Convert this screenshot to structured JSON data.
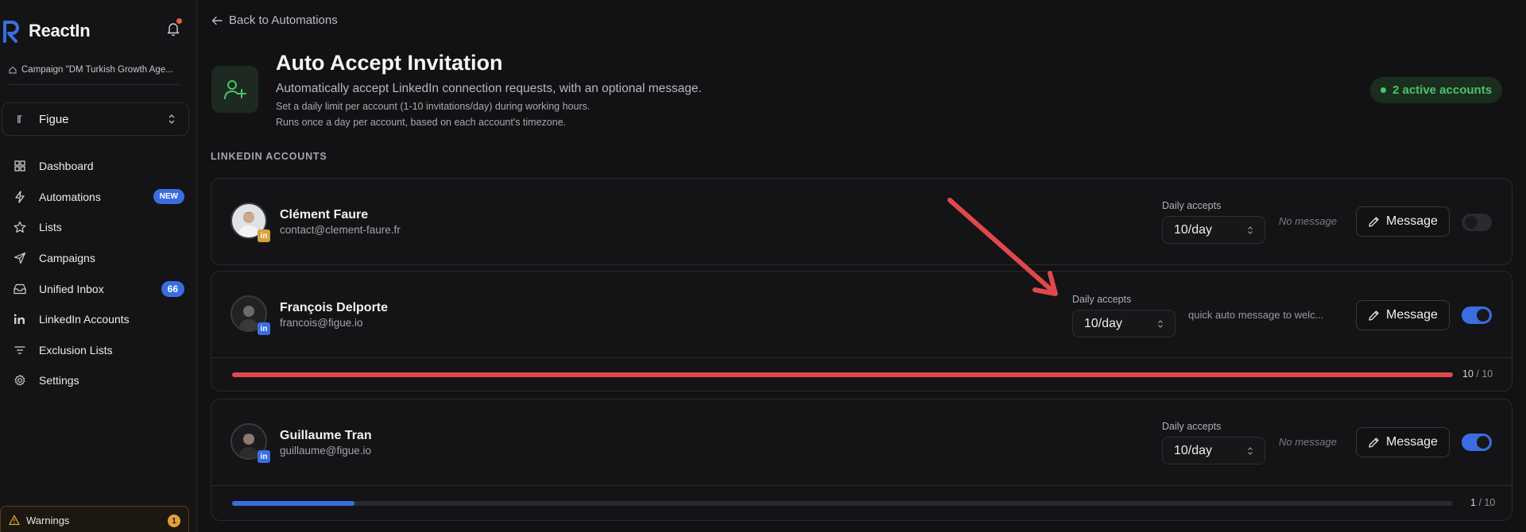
{
  "app": {
    "name": "ReactIn"
  },
  "sidebar": {
    "campaign": "Campaign \"DM Turkish Growth Age...",
    "workspace": "Figue",
    "items": [
      {
        "label": "Dashboard",
        "icon": "grid-icon"
      },
      {
        "label": "Automations",
        "icon": "bolt-icon",
        "badge": "NEW"
      },
      {
        "label": "Lists",
        "icon": "star-icon"
      },
      {
        "label": "Campaigns",
        "icon": "send-icon"
      },
      {
        "label": "Unified Inbox",
        "icon": "inbox-icon",
        "badge": "66"
      },
      {
        "label": "LinkedIn Accounts",
        "icon": "linkedin-icon"
      },
      {
        "label": "Exclusion Lists",
        "icon": "filter-icon"
      },
      {
        "label": "Settings",
        "icon": "gear-icon"
      }
    ],
    "warnings": {
      "label": "Warnings",
      "count": "1"
    }
  },
  "header": {
    "back_label": "Back to Automations",
    "title": "Auto Accept Invitation",
    "subtitle": "Automatically accept LinkedIn connection requests, with an optional message.",
    "desc1": "Set a daily limit per account (1-10 invitations/day) during working hours.",
    "desc2": "Runs once a day per account, based on each account's timezone.",
    "active_accounts": "2 active accounts"
  },
  "section_label": "LINKEDIN ACCOUNTS",
  "accounts": [
    {
      "name": "Clément Faure",
      "email": "contact@clement-faure.fr",
      "daily_label": "Daily accepts",
      "daily_value": "10/day",
      "message_preview": "No message",
      "message_button": "Message",
      "enabled": false,
      "badge_color": "#d9a13a"
    },
    {
      "name": "François Delporte",
      "email": "francois@figue.io",
      "daily_label": "Daily accepts",
      "daily_value": "10/day",
      "message_preview": "quick auto message to welc...",
      "message_button": "Message",
      "enabled": true,
      "badge_color": "#3a6ee0",
      "progress": {
        "used": "10",
        "separator": "/",
        "total": "10",
        "fraction": 1.0,
        "color": "#e0484d"
      }
    },
    {
      "name": "Guillaume Tran",
      "email": "guillaume@figue.io",
      "daily_label": "Daily accepts",
      "daily_value": "10/day",
      "message_preview": "No message",
      "message_button": "Message",
      "enabled": true,
      "badge_color": "#3a6ee0",
      "progress": {
        "used": "1",
        "separator": "/",
        "total": "10",
        "fraction": 0.1,
        "color": "#3a6ee0"
      }
    }
  ],
  "colors": {
    "accent": "#3a6ee0",
    "success": "#4cc46a",
    "annotation_arrow": "#e0484d"
  }
}
